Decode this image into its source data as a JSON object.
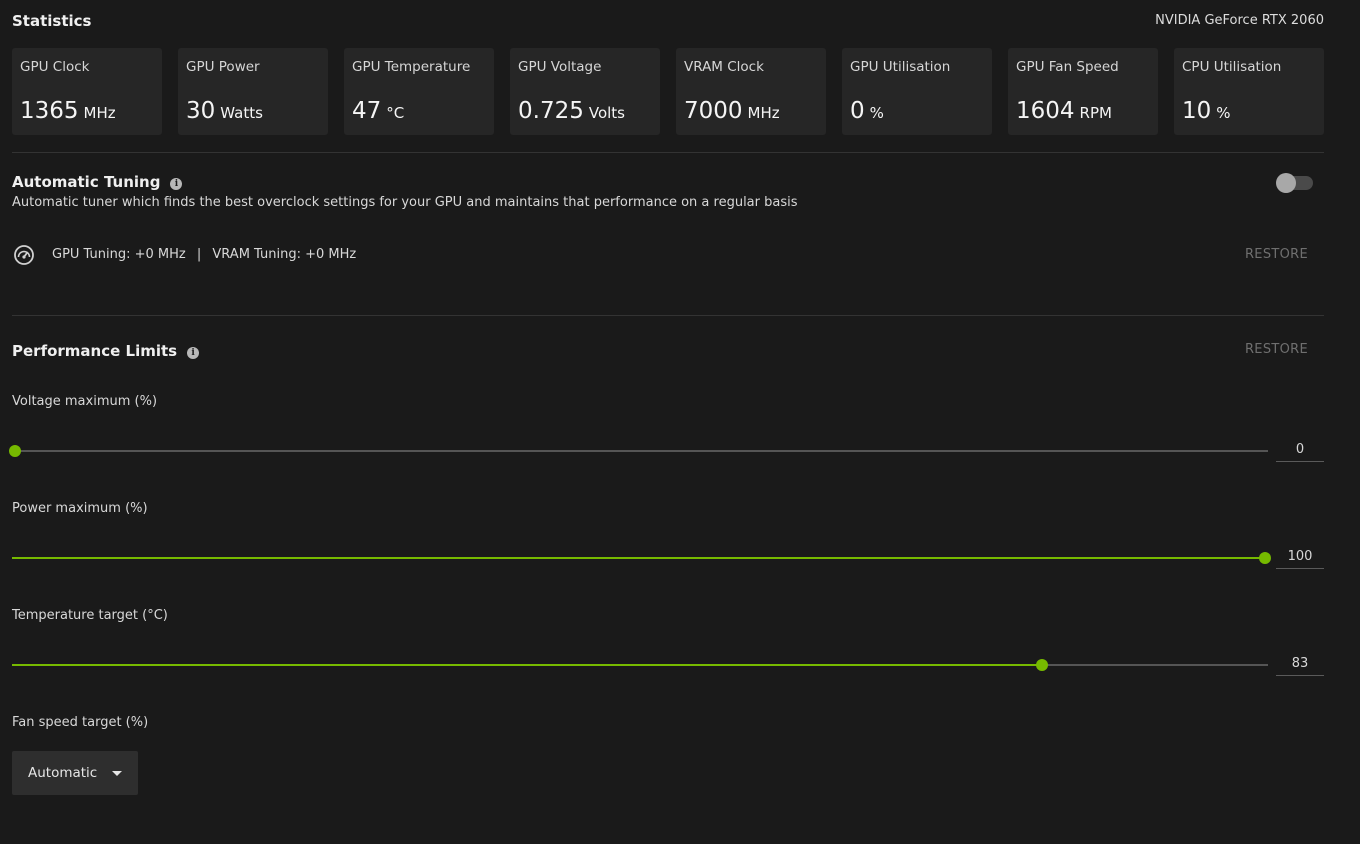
{
  "header": {
    "title": "Statistics",
    "gpu_name": "NVIDIA GeForce RTX 2060"
  },
  "stats": [
    {
      "label": "GPU Clock",
      "value": "1365",
      "unit": "MHz"
    },
    {
      "label": "GPU Power",
      "value": "30",
      "unit": "Watts"
    },
    {
      "label": "GPU Temperature",
      "value": "47",
      "unit": "°C"
    },
    {
      "label": "GPU Voltage",
      "value": "0.725",
      "unit": "Volts"
    },
    {
      "label": "VRAM Clock",
      "value": "7000",
      "unit": "MHz"
    },
    {
      "label": "GPU Utilisation",
      "value": "0",
      "unit": "%"
    },
    {
      "label": "GPU Fan Speed",
      "value": "1604",
      "unit": "RPM"
    },
    {
      "label": "CPU Utilisation",
      "value": "10",
      "unit": "%"
    }
  ],
  "auto_tuning": {
    "title": "Automatic Tuning",
    "info_icon": "i",
    "description": "Automatic tuner which finds the best overclock settings for your GPU and maintains that performance on a regular basis",
    "enabled": false,
    "gpu_tuning": "GPU Tuning: +0 MHz",
    "separator": "|",
    "vram_tuning": "VRAM Tuning: +0 MHz",
    "restore_label": "RESTORE"
  },
  "performance_limits": {
    "title": "Performance Limits",
    "info_icon": "i",
    "restore_label": "RESTORE",
    "sliders": [
      {
        "label": "Voltage maximum (%)",
        "value": "0",
        "fraction": 0.0
      },
      {
        "label": "Power maximum (%)",
        "value": "100",
        "fraction": 1.0
      },
      {
        "label": "Temperature target (°C)",
        "value": "83",
        "fraction": 0.82
      }
    ],
    "fan": {
      "label": "Fan speed target (%)",
      "selected": "Automatic"
    }
  },
  "colors": {
    "accent": "#76b900",
    "background": "#1a1a1a",
    "card": "#262626"
  }
}
